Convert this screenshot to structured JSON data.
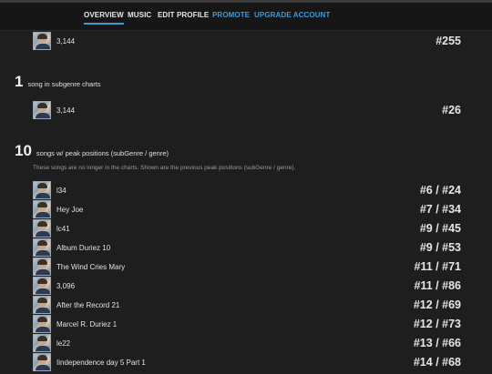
{
  "nav": {
    "items": [
      {
        "label": "OVERVIEW"
      },
      {
        "label": "MUSIC"
      },
      {
        "label": "EDIT PROFILE"
      },
      {
        "label": "PROMOTE"
      },
      {
        "label": "UPGRADE ACCOUNT"
      }
    ],
    "active_color": "#3a9bd9"
  },
  "genre_section": {
    "songs": [
      {
        "title": "3,144",
        "rank": "#255"
      }
    ]
  },
  "subgenre_section": {
    "count": "1",
    "label": "song in subgenre charts",
    "songs": [
      {
        "title": "3,144",
        "rank": "#26"
      }
    ]
  },
  "peak_section": {
    "count": "10",
    "label": "songs w/ peak positions (subGenre / genre)",
    "note": "These songs are no longer in the charts. Shown are the previous peak positions (subGenre / genre).",
    "songs": [
      {
        "title": "l34",
        "rank": "#6 / #24"
      },
      {
        "title": "Hey Joe",
        "rank": "#7 / #34"
      },
      {
        "title": "lc41",
        "rank": "#9 / #45"
      },
      {
        "title": "Album Duriez 10",
        "rank": "#9 / #53"
      },
      {
        "title": "The Wind Cries Mary",
        "rank": "#11 / #71"
      },
      {
        "title": "3,096",
        "rank": "#11 / #86"
      },
      {
        "title": "After the Record 21",
        "rank": "#12 / #69"
      },
      {
        "title": "Marcel R. Duriez 1",
        "rank": "#12 / #73"
      },
      {
        "title": "le22",
        "rank": "#13 / #66"
      },
      {
        "title": "Iindependence day 5 Part 1",
        "rank": "#14 / #68"
      }
    ]
  }
}
